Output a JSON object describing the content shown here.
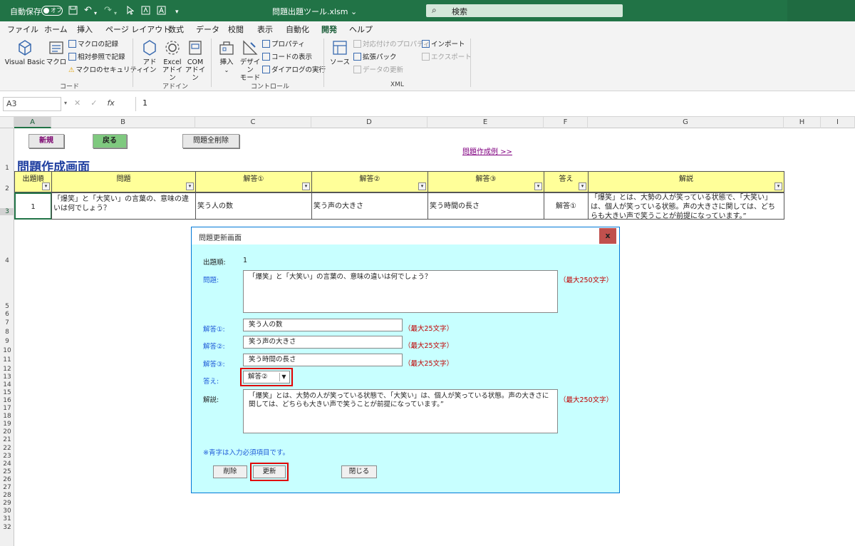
{
  "titlebar": {
    "autosave_label": "自動保存",
    "autosave_state": "オフ",
    "filename": "問題出題ツール.xlsm",
    "search_placeholder": "検索"
  },
  "tabs": [
    "ファイル",
    "ホーム",
    "挿入",
    "ページ レイアウト",
    "数式",
    "データ",
    "校閲",
    "表示",
    "自動化",
    "開発",
    "ヘルプ"
  ],
  "active_tab": "開発",
  "ribbon": {
    "code": {
      "label": "コード",
      "vb": "Visual Basic",
      "macro": "マクロ",
      "record": "マクロの記録",
      "relative": "相対参照で記録",
      "security": "マクロのセキュリティ"
    },
    "addins": {
      "label": "アドイン",
      "addin_l1": "アド",
      "addin_l2": "イン",
      "excel_l1": "Excel",
      "excel_l2": "アドイン",
      "com_l1": "COM",
      "com_l2": "アドイン"
    },
    "controls": {
      "label": "コントロール",
      "insert": "挿入",
      "design_l1": "デザイン",
      "design_l2": "モード",
      "props": "プロパティ",
      "viewcode": "コードの表示",
      "rundialog": "ダイアログの実行"
    },
    "xml": {
      "label": "XML",
      "source": "ソース",
      "mapprops": "対応付けのプロパティ",
      "expansion": "拡張パック",
      "refresh": "データの更新",
      "import": "インポート",
      "export": "エクスポート"
    }
  },
  "formula_bar": {
    "name_box": "A3",
    "value": "1"
  },
  "columns": [
    "A",
    "B",
    "C",
    "D",
    "E",
    "F",
    "G",
    "H",
    "I"
  ],
  "rows": [
    "1",
    "2",
    "3",
    "4",
    "5",
    "6",
    "7",
    "8",
    "9",
    "10",
    "11",
    "12",
    "13",
    "14",
    "15",
    "16",
    "17",
    "18",
    "19",
    "20",
    "21",
    "22",
    "23",
    "24",
    "25",
    "26",
    "27",
    "28",
    "29",
    "30",
    "31",
    "32"
  ],
  "sheet": {
    "btn_new": "新規",
    "btn_back": "戻る",
    "btn_delete_all": "問題全削除",
    "example_link": "問題作成例 >>",
    "title": "問題作成画面",
    "headers": [
      "出題順",
      "問題",
      "解答①",
      "解答②",
      "解答③",
      "答え",
      "解説"
    ],
    "row": {
      "order": "1",
      "question": "「爆笑」と「大笑い」の言葉の、意味の違いは何でしょう？",
      "ans1": "笑う人の数",
      "ans2": "笑う声の大きさ",
      "ans3": "笑う時間の長さ",
      "answer": "解答①",
      "explanation": "「爆笑」とは、大勢の人が笑っている状態で、「大笑い」は、個人が笑っている状態。声の大きさに関しては、どちらも大きい声で笑うことが前提になっています。”"
    }
  },
  "dialog": {
    "title": "問題更新画面",
    "close": "x",
    "order_label": "出題順:",
    "order_value": "1",
    "question_label": "問題:",
    "question_value": "「爆笑」と「大笑い」の言葉の、意味の違いは何でしょう？",
    "question_limit": "（最大250文字）",
    "ans1_label": "解答①:",
    "ans1_value": "笑う人の数",
    "ans2_label": "解答②:",
    "ans2_value": "笑う声の大きさ",
    "ans3_label": "解答③:",
    "ans3_value": "笑う時間の長さ",
    "ans_limit": "（最大25文字）",
    "answer_label": "答え:",
    "answer_value": "解答②",
    "expl_label": "解説:",
    "expl_value": "「爆笑」とは、大勢の人が笑っている状態で、「大笑い」は、個人が笑っている状態。声の大きさに関しては、どちらも大きい声で笑うことが前提になっています。”",
    "expl_limit": "（最大250文字）",
    "note": "※青字は入力必須項目です。",
    "btn_delete": "削除",
    "btn_update": "更新",
    "btn_close": "閉じる"
  }
}
